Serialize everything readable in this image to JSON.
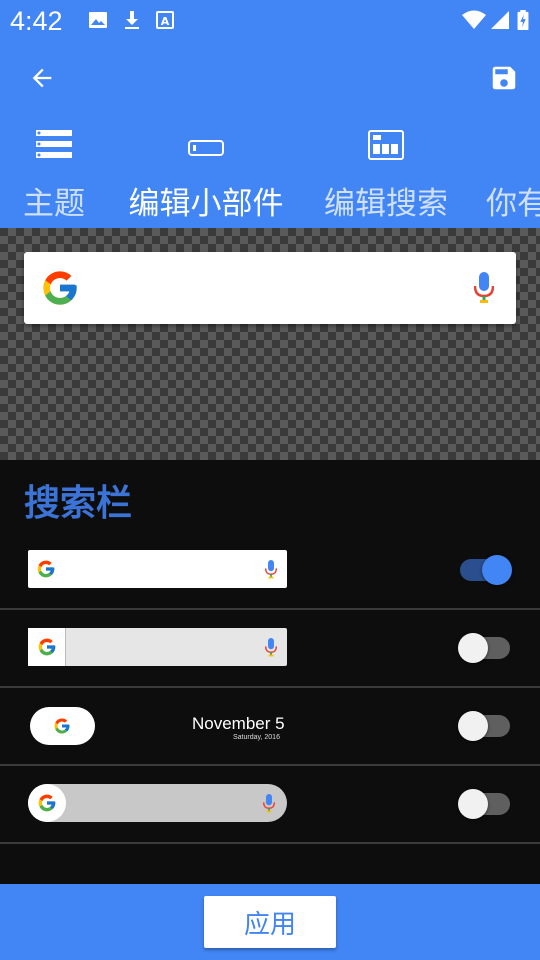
{
  "status_bar": {
    "time": "4:42",
    "left_icons": [
      "image-icon",
      "download-icon",
      "text-a-icon"
    ],
    "right_icons": [
      "wifi-icon",
      "signal-icon",
      "battery-icon"
    ]
  },
  "app_bar": {
    "back_icon": "arrow-back-icon",
    "save_icon": "save-icon",
    "tabs": [
      {
        "label": "主题",
        "icon": "list-icon",
        "active": false
      },
      {
        "label": "编辑小部件",
        "icon": "widget-icon",
        "active": true
      },
      {
        "label": "编辑搜索",
        "icon": "search-layout-icon",
        "active": false
      },
      {
        "label": "你有",
        "icon": "",
        "active": false
      }
    ]
  },
  "section": {
    "title": "搜索栏"
  },
  "rows": [
    {
      "style": "white-bar",
      "enabled": true
    },
    {
      "style": "grey-bar-with-g-box",
      "enabled": false
    },
    {
      "style": "pill-with-date",
      "enabled": false,
      "date_main": "November 5",
      "date_sub": "Saturday, 2016"
    },
    {
      "style": "rounded-grey-bar",
      "enabled": false
    }
  ],
  "bottom": {
    "apply_label": "应用"
  },
  "colors": {
    "primary": "#4285f4",
    "section_title": "#3b73d6",
    "background": "#0d0d0d",
    "toggle_on_track": "#2b4f8e",
    "toggle_on_knob": "#4285f4",
    "toggle_off_track": "#5f5f5f",
    "toggle_off_knob": "#f1f1f1"
  }
}
